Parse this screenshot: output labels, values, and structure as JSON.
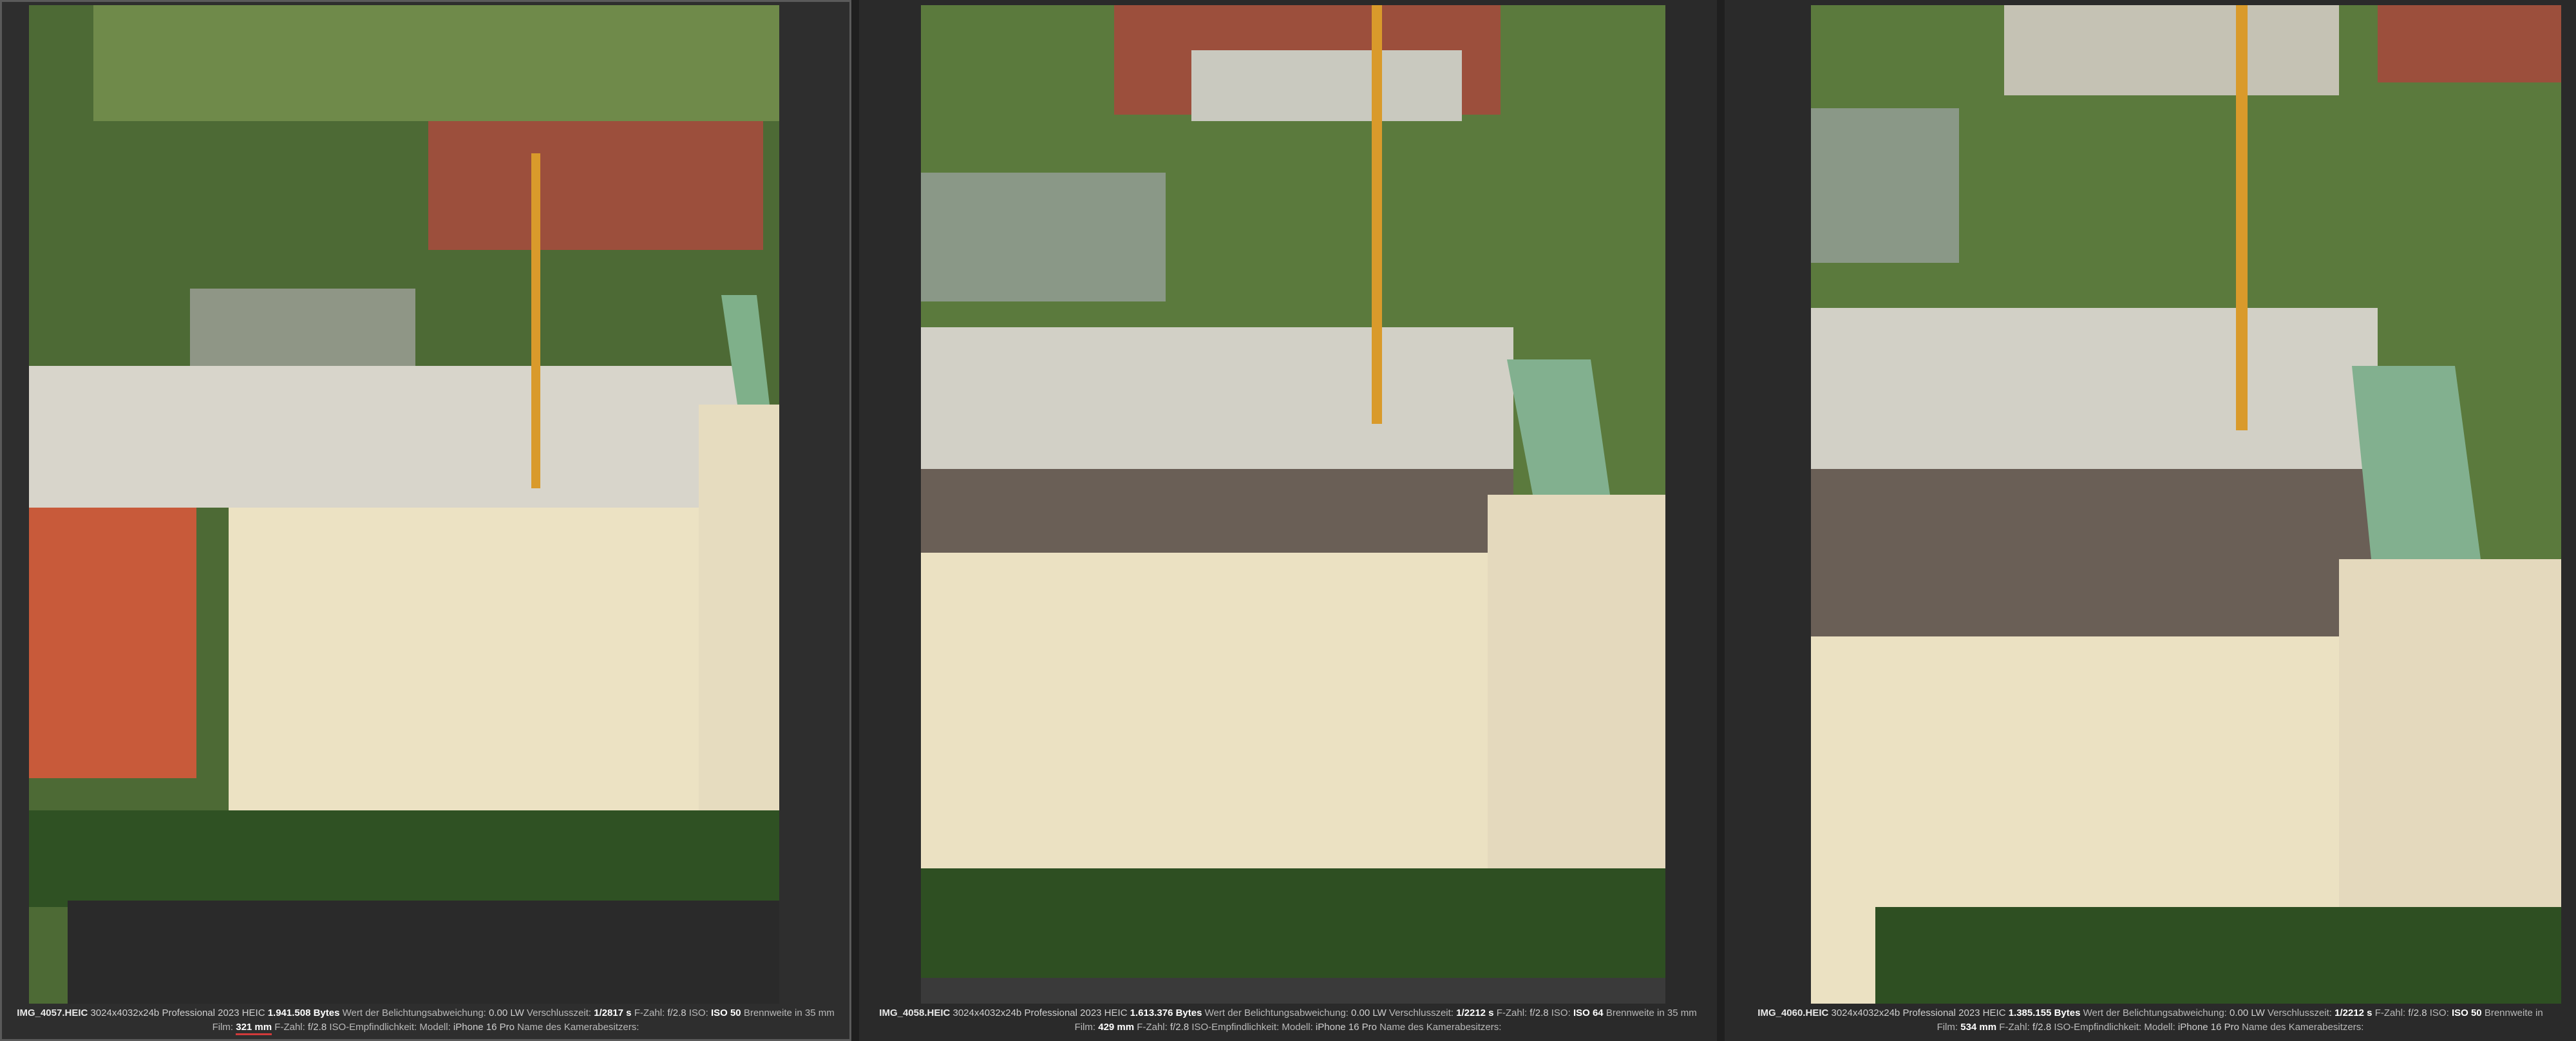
{
  "panels": [
    {
      "filename": "IMG_4057.HEIC",
      "resolution": "3024x4032x24b",
      "software": "Professional 2023 HEIC",
      "size_label": "1.941.508 Bytes",
      "exposure_label": "Wert der Belichtungsabweichung:",
      "exposure": "0.00 LW",
      "shutter_label": "Verschlusszeit:",
      "shutter": "1/2817 s",
      "fnum_label": "F-Zahl:",
      "fnum": "f/2.8",
      "iso_label": "ISO:",
      "iso": "ISO 50",
      "focal35_label": "Brennweite in 35 mm",
      "film_label": "Film:",
      "focal": "321 mm",
      "fnum2_label": "F-Zahl:",
      "fnum2": "f/2.8",
      "iso2_label": "ISO-Empfindlichkeit:",
      "model_label": "Modell:",
      "model": "iPhone 16 Pro",
      "owner_label": "Name des Kamerabesitzers:"
    },
    {
      "filename": "IMG_4058.HEIC",
      "resolution": "3024x4032x24b",
      "software": "Professional 2023 HEIC",
      "size_label": "1.613.376 Bytes",
      "exposure_label": "Wert der Belichtungsabweichung:",
      "exposure": "0.00 LW",
      "shutter_label": "Verschlusszeit:",
      "shutter": "1/2212 s",
      "fnum_label": "F-Zahl:",
      "fnum": "f/2.8",
      "iso_label": "ISO:",
      "iso": "ISO 64",
      "focal35_label": "Brennweite in 35 mm",
      "film_label": "Film:",
      "focal": "429 mm",
      "fnum2_label": "F-Zahl:",
      "fnum2": "f/2.8",
      "iso2_label": "ISO-Empfindlichkeit:",
      "model_label": "Modell:",
      "model": "iPhone 16 Pro",
      "owner_label": "Name des Kamerabesitzers:"
    },
    {
      "filename": "IMG_4060.HEIC",
      "resolution": "3024x4032x24b",
      "software": "Professional 2023 HEIC",
      "size_label": "1.385.155 Bytes",
      "exposure_label": "Wert der Belichtungsabweichung:",
      "exposure": "0.00 LW",
      "shutter_label": "Verschlusszeit:",
      "shutter": "1/2212 s",
      "fnum_label": "F-Zahl:",
      "fnum": "f/2.8",
      "iso_label": "ISO:",
      "iso": "ISO 50",
      "focal35_label": "Brennweite in",
      "film_label": "Film:",
      "focal": "534 mm",
      "fnum2_label": "F-Zahl:",
      "fnum2": "f/2.8",
      "iso2_label": "ISO-Empfindlichkeit:",
      "model_label": "Modell:",
      "model": "iPhone 16 Pro",
      "owner_label": "Name des Kamerabesitzers:"
    }
  ]
}
